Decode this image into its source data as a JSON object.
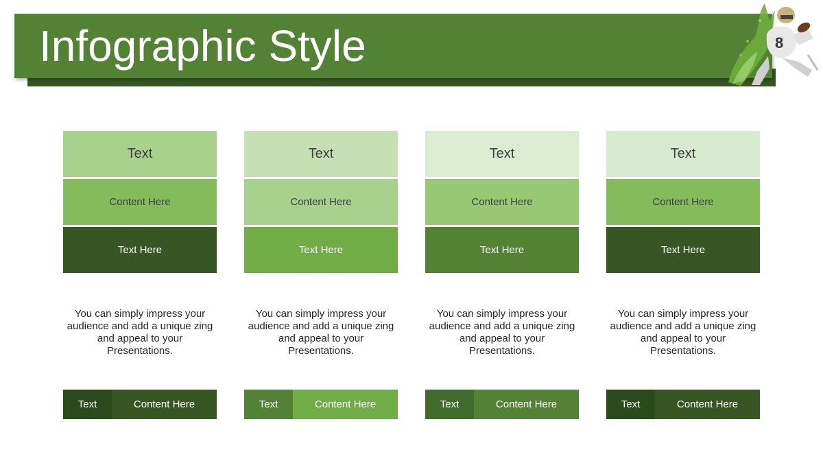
{
  "title": "Infographic Style",
  "columns": [
    {
      "header": "Text",
      "sub": "Content Here",
      "label": "Text Here",
      "desc": "You can simply impress your audience and add a unique zing and appeal to your Presentations.",
      "bar_left": "Text",
      "bar_right": "Content Here",
      "colors": {
        "header": "#a9d18e",
        "sub": "#84bc5c",
        "label": "#375623",
        "bar_left": "#2b4a1c",
        "bar_right": "#375623"
      }
    },
    {
      "header": "Text",
      "sub": "Content Here",
      "label": "Text Here",
      "desc": "You can simply impress your audience and add a unique zing and appeal to your Presentations.",
      "bar_left": "Text",
      "bar_right": "Content Here",
      "colors": {
        "header": "#c5e0b4",
        "sub": "#a9d18e",
        "label": "#70ad47",
        "bar_left": "#548235",
        "bar_right": "#70ad47"
      }
    },
    {
      "header": "Text",
      "sub": "Content Here",
      "label": "Text Here",
      "desc": "You can simply impress your audience and add a unique zing and appeal to your Presentations.",
      "bar_left": "Text",
      "bar_right": "Content Here",
      "colors": {
        "header": "#dbedd1",
        "sub": "#98c874",
        "label": "#548235",
        "bar_left": "#406b2b",
        "bar_right": "#548235"
      }
    },
    {
      "header": "Text",
      "sub": "Content Here",
      "label": "Text Here",
      "desc": "You can simply impress your audience and add a unique zing and appeal to your Presentations.",
      "bar_left": "Text",
      "bar_right": "Content Here",
      "colors": {
        "header": "#d6ead0",
        "sub": "#84bc5c",
        "label": "#375623",
        "bar_left": "#2b4a1c",
        "bar_right": "#375623"
      }
    }
  ]
}
